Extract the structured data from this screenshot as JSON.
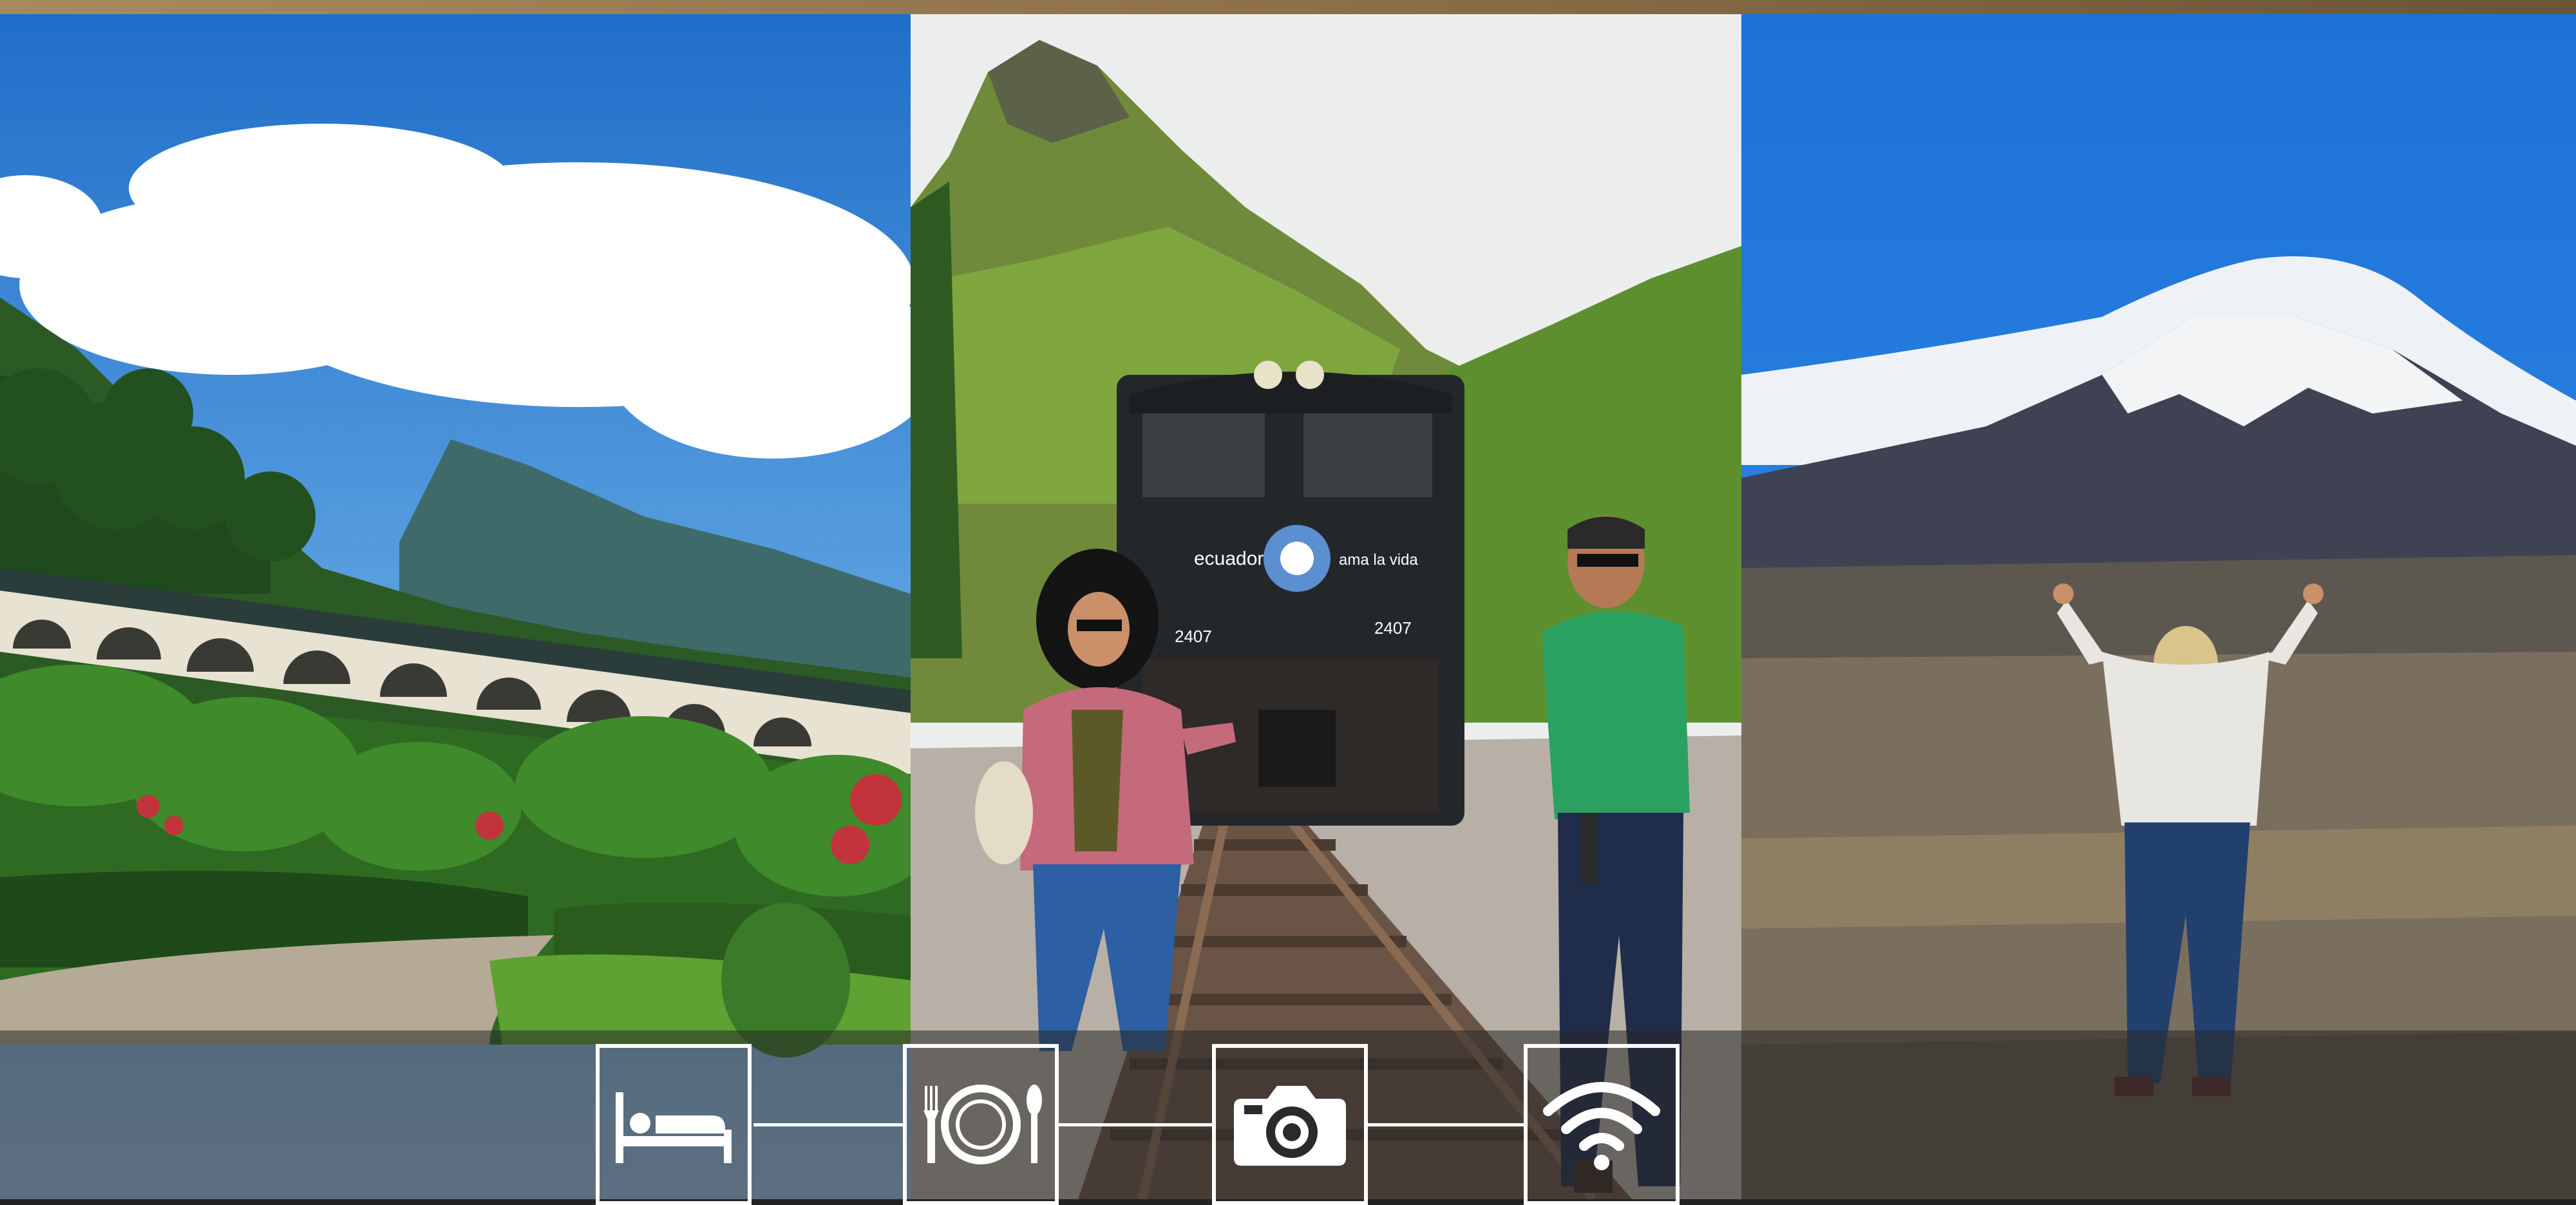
{
  "colors": {
    "top_bar": "#8c7048",
    "overlay": "#282828",
    "icon_stroke": "#ffffff"
  },
  "photos": [
    {
      "id": "hacienda-garden",
      "train_text": ""
    },
    {
      "id": "train-tracks",
      "locomotive_brand": "ecuador",
      "locomotive_slogan": "ama la vida",
      "locomotive_number": "2407"
    },
    {
      "id": "volcano"
    }
  ],
  "amenities": [
    {
      "name": "lodging",
      "icon": "bed-icon"
    },
    {
      "name": "dining",
      "icon": "plate-cutlery-icon"
    },
    {
      "name": "photography",
      "icon": "camera-icon"
    },
    {
      "name": "wifi",
      "icon": "wifi-icon"
    }
  ]
}
